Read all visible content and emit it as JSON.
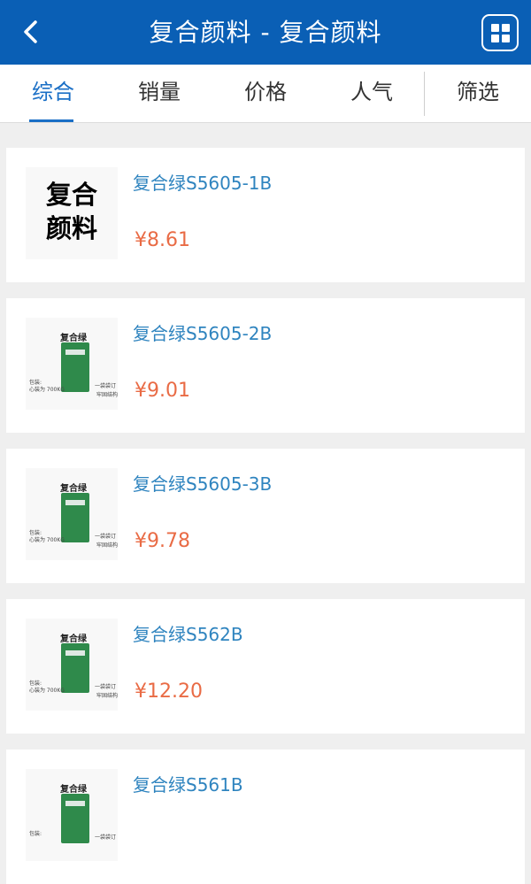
{
  "header": {
    "title": "复合颜料 - 复合颜料",
    "back_icon": "chevron-left-icon",
    "menu_icon": "grid-icon"
  },
  "tabs": [
    {
      "label": "综合",
      "active": true
    },
    {
      "label": "销量",
      "active": false
    },
    {
      "label": "价格",
      "active": false
    },
    {
      "label": "人气",
      "active": false
    },
    {
      "label": "筛选",
      "active": false
    }
  ],
  "products": [
    {
      "name": "复合绿S5605-1B",
      "price": "¥8.61",
      "image_text": "复合\n颜料"
    },
    {
      "name": "复合绿S5605-2B",
      "price": "¥9.01",
      "image_label": "复合绿"
    },
    {
      "name": "复合绿S5605-3B",
      "price": "¥9.78",
      "image_label": "复合绿"
    },
    {
      "name": "复合绿S562B",
      "price": "¥12.20",
      "image_label": "复合绿"
    },
    {
      "name": "复合绿S561B",
      "price": "",
      "image_label": "复合绿"
    }
  ],
  "colors": {
    "header": "#0a5fb5",
    "accent": "#1a6fc6",
    "price": "#e96b45",
    "name": "#2f84bf"
  }
}
